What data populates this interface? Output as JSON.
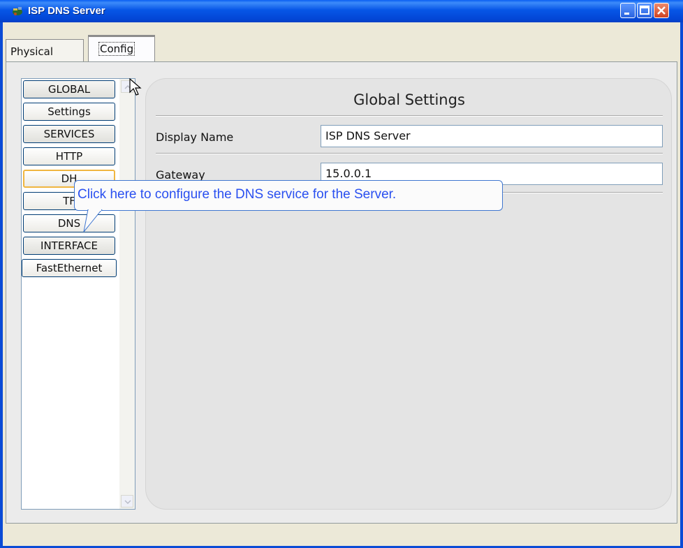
{
  "window": {
    "title": "ISP DNS Server",
    "icons": {
      "app": "server-icon",
      "minimize": "minimize-icon",
      "maximize": "maximize-icon",
      "close": "close-icon"
    }
  },
  "tabs": [
    {
      "label": "Physical",
      "active": false
    },
    {
      "label": "Config",
      "active": true
    }
  ],
  "sidebar": {
    "items": [
      {
        "label": "GLOBAL",
        "type": "header"
      },
      {
        "label": "Settings",
        "type": "item"
      },
      {
        "label": "SERVICES",
        "type": "header"
      },
      {
        "label": "HTTP",
        "type": "item"
      },
      {
        "label": "DHCP",
        "type": "item",
        "visible_text": "DH"
      },
      {
        "label": "TFTP",
        "type": "item",
        "visible_text": "TF"
      },
      {
        "label": "DNS",
        "type": "item"
      },
      {
        "label": "INTERFACE",
        "type": "header"
      },
      {
        "label": "FastEthernet",
        "type": "item"
      }
    ]
  },
  "global_settings": {
    "title": "Global Settings",
    "fields": [
      {
        "label": "Display Name",
        "value": "ISP DNS Server"
      },
      {
        "label": "Gateway",
        "value": "15.0.0.1"
      }
    ]
  },
  "tooltip": {
    "text": "Click here to configure the DNS service for the Server."
  },
  "colors": {
    "titlebar": "#0756e6",
    "tab_accent": "#f2a839",
    "tooltip_text": "#2a50f0",
    "panel_bg": "#e4e4e4"
  }
}
